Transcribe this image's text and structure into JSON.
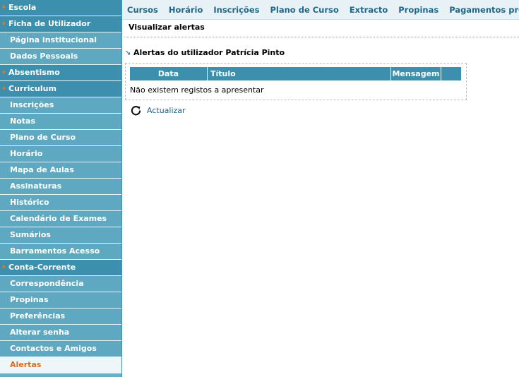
{
  "sidebar": {
    "items": [
      {
        "label": "Escola",
        "type": "section"
      },
      {
        "label": "Ficha de Utilizador",
        "type": "section"
      },
      {
        "label": "Página institucional",
        "type": "item"
      },
      {
        "label": "Dados Pessoais",
        "type": "item"
      },
      {
        "label": "Absentismo",
        "type": "section"
      },
      {
        "label": "Curriculum",
        "type": "section"
      },
      {
        "label": "Inscrições",
        "type": "item"
      },
      {
        "label": "Notas",
        "type": "item"
      },
      {
        "label": "Plano de Curso",
        "type": "item"
      },
      {
        "label": "Horário",
        "type": "item"
      },
      {
        "label": "Mapa de Aulas",
        "type": "item"
      },
      {
        "label": "Assinaturas",
        "type": "item"
      },
      {
        "label": "Histórico",
        "type": "item"
      },
      {
        "label": "Calendário de Exames",
        "type": "item"
      },
      {
        "label": "Sumários",
        "type": "item"
      },
      {
        "label": "Barramentos Acesso",
        "type": "item"
      },
      {
        "label": "Conta-Corrente",
        "type": "section"
      },
      {
        "label": "Correspondência",
        "type": "item"
      },
      {
        "label": "Propinas",
        "type": "item"
      },
      {
        "label": "Preferências",
        "type": "item"
      },
      {
        "label": "Alterar senha",
        "type": "item"
      },
      {
        "label": "Contactos e Amigos",
        "type": "item"
      },
      {
        "label": "Alertas",
        "type": "active"
      }
    ]
  },
  "topnav": {
    "links": [
      "Cursos",
      "Horário",
      "Inscrições",
      "Plano de Curso",
      "Extracto",
      "Propinas",
      "Pagamentos propinas"
    ]
  },
  "page": {
    "heading": "Visualizar alertas",
    "section_title": "Alertas do utilizador Patrícia Pinto"
  },
  "table": {
    "headers": [
      "Data",
      "Título",
      "Mensagem",
      ""
    ],
    "empty_message": "Não existem registos a apresentar"
  },
  "actions": {
    "refresh_label": "Actualizar"
  },
  "colors": {
    "sidebar_bg": "#5fa8c1",
    "section_bg": "#3d8fae",
    "active_text": "#e06b1b",
    "link": "#1e6888",
    "arrow": "#e87722"
  },
  "icons": {
    "section_marker": "arrow-right-icon",
    "section_title_marker": "arrow-down-right-icon",
    "refresh": "refresh-icon"
  }
}
